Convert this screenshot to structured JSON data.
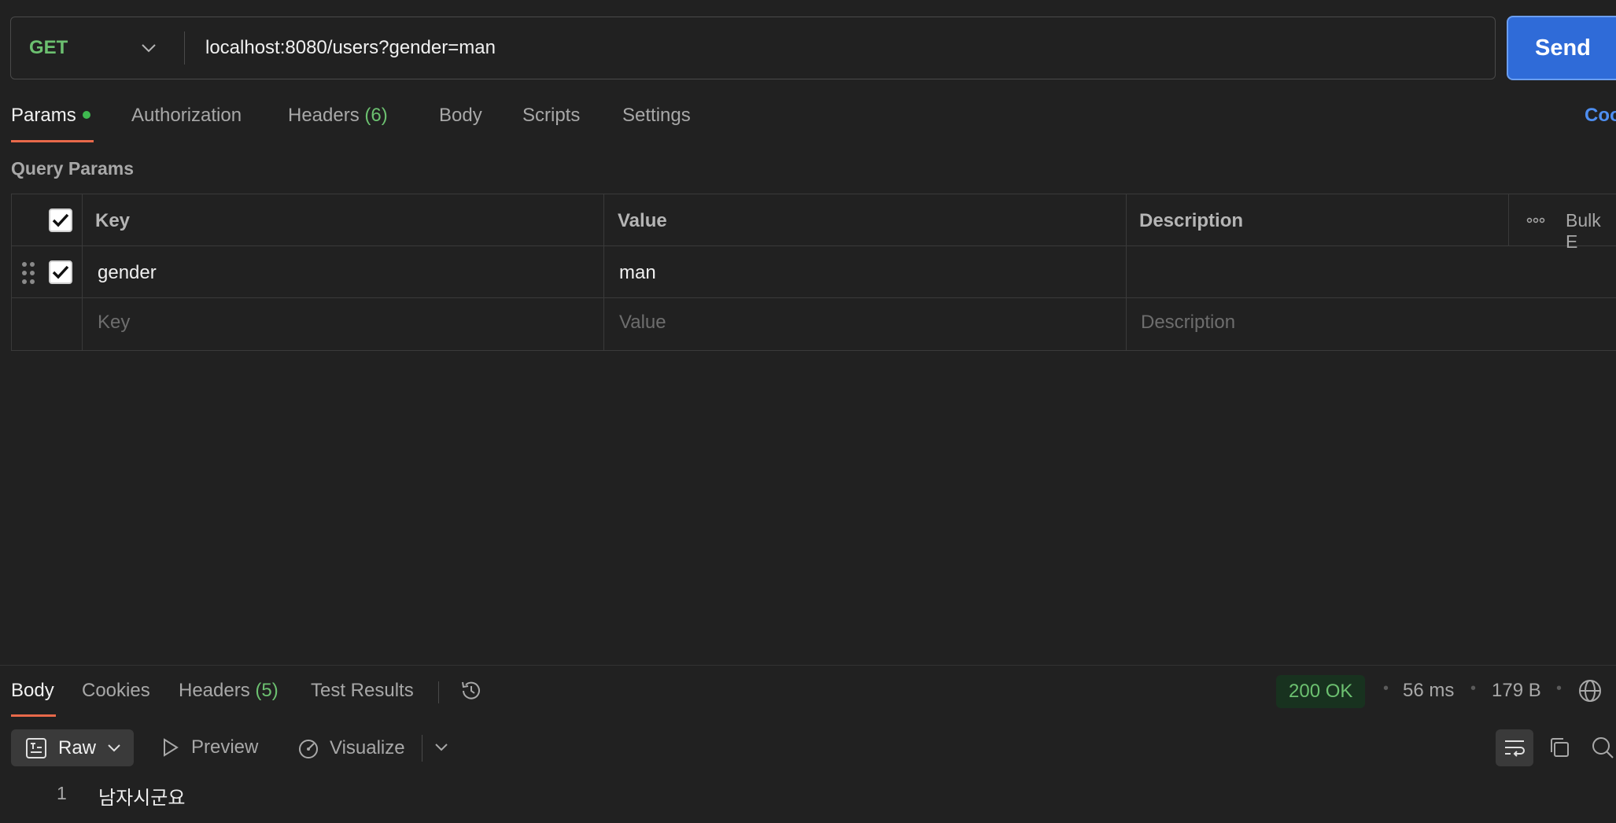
{
  "request": {
    "method": "GET",
    "url": "localhost:8080/users?gender=man",
    "send_label": "Send"
  },
  "tabs": {
    "params": "Params",
    "authorization": "Authorization",
    "headers": "Headers",
    "headers_count": "(6)",
    "body": "Body",
    "scripts": "Scripts",
    "settings": "Settings",
    "code": "Coo"
  },
  "query_params": {
    "title": "Query Params",
    "columns": {
      "key": "Key",
      "value": "Value",
      "description": "Description"
    },
    "bulk_edit": "Bulk E",
    "rows": [
      {
        "checked": true,
        "key": "gender",
        "value": "man",
        "description": ""
      }
    ],
    "placeholders": {
      "key": "Key",
      "value": "Value",
      "description": "Description"
    }
  },
  "response": {
    "tabs": {
      "body": "Body",
      "cookies": "Cookies",
      "headers": "Headers",
      "headers_count": "(5)",
      "test_results": "Test Results"
    },
    "status": "200 OK",
    "time": "56 ms",
    "size": "179 B",
    "format": "Raw",
    "preview": "Preview",
    "visualize": "Visualize",
    "lines": [
      {
        "number": "1",
        "text": "남자시군요"
      }
    ]
  },
  "colors": {
    "accent_underline": "#e8694a",
    "method_green": "#6cc070",
    "send_blue": "#2f6bd8",
    "status_green": "#6cc070"
  }
}
